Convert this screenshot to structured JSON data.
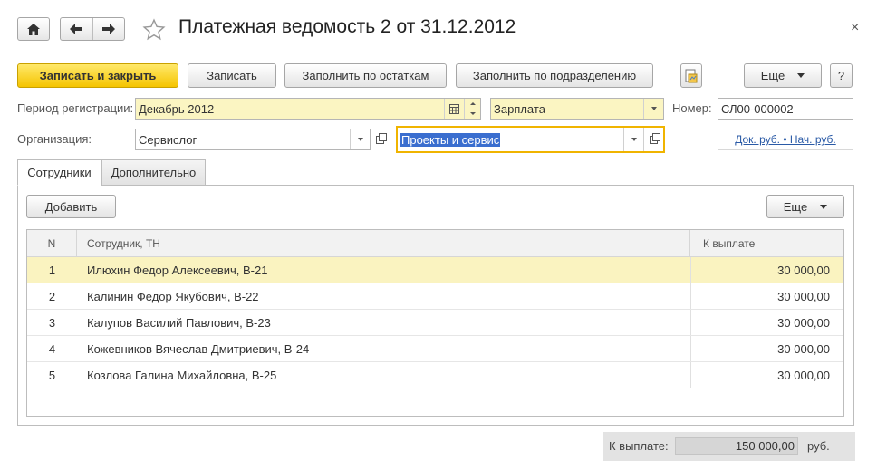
{
  "window": {
    "title": "Платежная ведомость 2 от 31.12.2012",
    "close_glyph": "×"
  },
  "nav": {
    "home_icon": "home-icon",
    "back_icon": "arrow-left-icon",
    "forward_icon": "arrow-right-icon",
    "favorite_icon": "star-icon",
    "back_glyph": "🡐",
    "forward_glyph": "🡒"
  },
  "toolbar": {
    "save_close": "Записать и закрыть",
    "save": "Записать",
    "fill_balances": "Заполнить по остаткам",
    "fill_department": "Заполнить по подразделению",
    "more": "Еще",
    "help": "?"
  },
  "form": {
    "period_label": "Период регистрации:",
    "period_value": "Декабрь 2012",
    "accrual_type": "Зарплата",
    "number_label": "Номер:",
    "number_value": "СЛ00-000002",
    "org_label": "Организация:",
    "org_value": "Сервислог",
    "department_value": "Проекты и сервис",
    "currency_link": "Док. руб. • Нач. руб."
  },
  "tabs": [
    {
      "label": "Сотрудники",
      "active": true
    },
    {
      "label": "Дополнительно",
      "active": false
    }
  ],
  "table_toolbar": {
    "add": "Добавить",
    "more": "Еще"
  },
  "table": {
    "columns": [
      "N",
      "Сотрудник, ТН",
      "К выплате"
    ],
    "rows": [
      {
        "n": "1",
        "employee": "Илюхин Федор Алексеевич, В-21",
        "amount": "30 000,00"
      },
      {
        "n": "2",
        "employee": "Калинин Федор Якубович, В-22",
        "amount": "30 000,00"
      },
      {
        "n": "3",
        "employee": "Калупов Василий Павлович, В-23",
        "amount": "30 000,00"
      },
      {
        "n": "4",
        "employee": "Кожевников Вячеслав Дмитриевич, В-24",
        "amount": "30 000,00"
      },
      {
        "n": "5",
        "employee": "Козлова Галина Михайловна, В-25",
        "amount": "30 000,00"
      }
    ],
    "selected_row": 0
  },
  "footer": {
    "total_label": "К выплате:",
    "total_value": "150 000,00",
    "currency": "руб."
  },
  "colors": {
    "primary_button": "#f5c400",
    "selected_row": "#faf3c0",
    "required_field": "#fbf5c2",
    "link": "#2a5aa6",
    "focus_border": "#f0b400"
  }
}
